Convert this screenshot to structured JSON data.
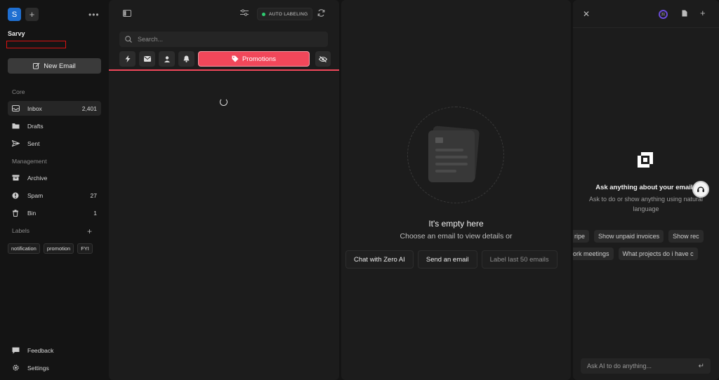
{
  "sidebar": {
    "workspace_initial": "S",
    "account_name": "Sarvy",
    "account_email": "",
    "new_email_label": "New Email",
    "sections": {
      "core": "Core",
      "management": "Management",
      "labels": "Labels"
    },
    "core_items": [
      {
        "label": "Inbox",
        "count": "2,401",
        "icon": "inbox-icon"
      },
      {
        "label": "Drafts",
        "count": "",
        "icon": "folder-icon"
      },
      {
        "label": "Sent",
        "count": "",
        "icon": "send-icon"
      }
    ],
    "management_items": [
      {
        "label": "Archive",
        "count": "",
        "icon": "archive-icon"
      },
      {
        "label": "Spam",
        "count": "27",
        "icon": "alert-icon"
      },
      {
        "label": "Bin",
        "count": "1",
        "icon": "trash-icon"
      }
    ],
    "labels": [
      "notification",
      "promotion",
      "FYI"
    ],
    "footer": {
      "feedback": "Feedback",
      "settings": "Settings"
    }
  },
  "list": {
    "auto_labeling": "AUTO LABELING",
    "search_placeholder": "Search...",
    "active_category": "Promotions",
    "accent_color": "#f1475a"
  },
  "detail": {
    "empty_title": "It's empty here",
    "empty_subtitle": "Choose an email to view details or",
    "actions": [
      "Chat with Zero AI",
      "Send an email",
      "Label last 50 emails"
    ]
  },
  "ai": {
    "usage_badge": "31",
    "title": "Ask anything about your emails",
    "subtitle": "Ask to do or show anything using natural language",
    "suggestions_row1": [
      "ripe",
      "Show unpaid invoices",
      "Show rec"
    ],
    "suggestions_row2": [
      "ork meetings",
      "What projects do i have c"
    ],
    "input_placeholder": "Ask AI to do anything..."
  }
}
